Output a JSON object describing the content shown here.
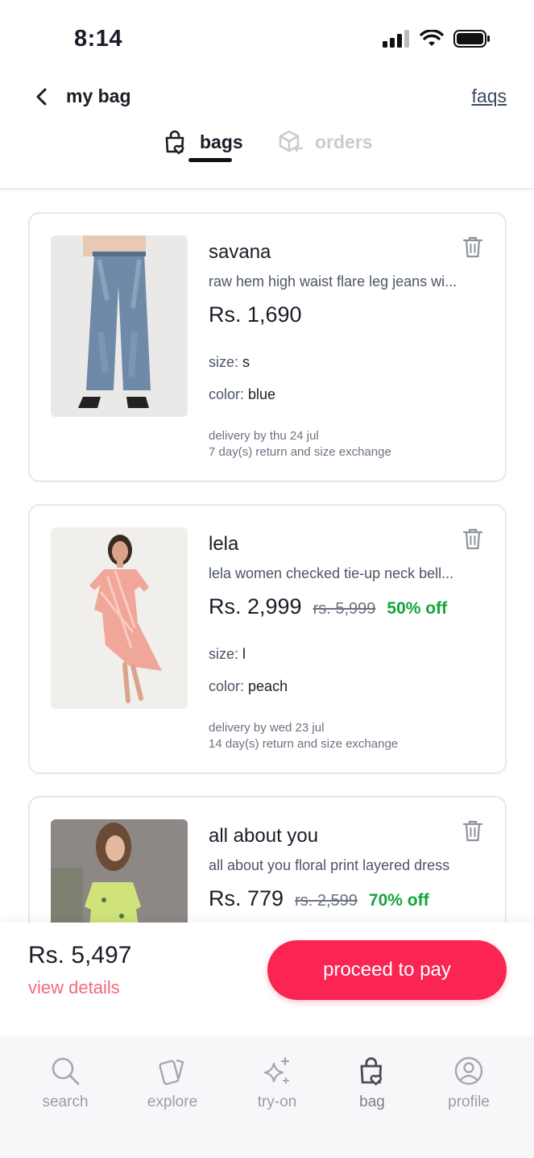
{
  "status_bar": {
    "time": "8:14",
    "icons": [
      "signal-icon",
      "wifi-icon",
      "battery-icon"
    ]
  },
  "header": {
    "title": "my bag",
    "faqs_label": "faqs"
  },
  "tabs": [
    {
      "label": "bags",
      "icon": "bag-heart-icon",
      "active": true
    },
    {
      "label": "orders",
      "icon": "box-return-icon",
      "active": false
    }
  ],
  "items": [
    {
      "brand": "savana",
      "description": "raw hem high waist flare leg jeans wi...",
      "price": "Rs. 1,690",
      "size_label": "size:",
      "size": "s",
      "color_label": "color:",
      "color": "blue",
      "delivery": "delivery by thu 24 jul",
      "returns": "7 day(s) return and size exchange"
    },
    {
      "brand": "lela",
      "description": "lela women checked tie-up neck bell...",
      "price": "Rs. 2,999",
      "mrp": "rs. 5,999",
      "discount": "50% off",
      "size_label": "size:",
      "size": "l",
      "color_label": "color:",
      "color": "peach",
      "delivery": "delivery by wed 23 jul",
      "returns": "14 day(s) return and size exchange"
    },
    {
      "brand": "all about you",
      "description": "all about you floral print layered dress",
      "price": "Rs. 779",
      "mrp": "rs. 2,599",
      "discount": "70% off"
    }
  ],
  "summary": {
    "total": "Rs. 5,497",
    "view_details": "view details",
    "pay_label": "proceed to pay"
  },
  "nav": [
    {
      "label": "search",
      "icon": "search-icon"
    },
    {
      "label": "explore",
      "icon": "cards-icon"
    },
    {
      "label": "try-on",
      "icon": "sparkles-icon"
    },
    {
      "label": "bag",
      "icon": "bag-heart-icon",
      "active": true
    },
    {
      "label": "profile",
      "icon": "user-circle-icon"
    }
  ],
  "colors": {
    "accent": "#fa2553",
    "discount": "#12a53b",
    "link": "#f06a7e"
  }
}
